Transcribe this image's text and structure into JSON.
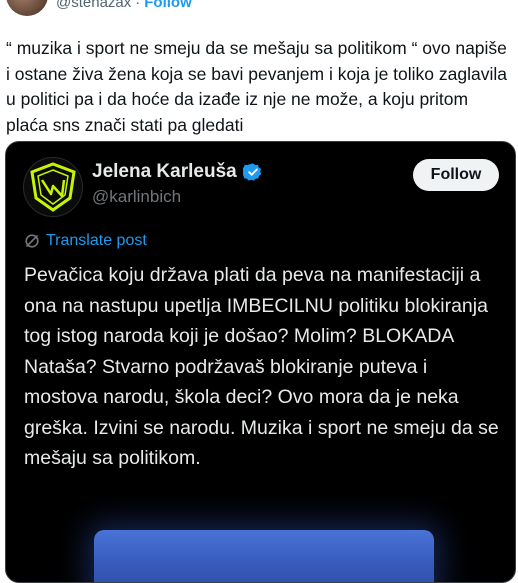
{
  "top": {
    "handle": "@stenazax",
    "follow_label": "Follow"
  },
  "tweet": {
    "text": "“ muzika i sport ne smeju da se mešaju sa politikom “ ovo napiše i ostane živa žena koja se bavi pevanjem i koja je toliko zaglavila u politici pa i da hoće da izađe iz nje ne može, a koju pritom plaća sns znači stati pa gledati"
  },
  "embed": {
    "name": "Jelena Karleuša",
    "handle": "@karlinbich",
    "follow_label": "Follow",
    "translate_label": "Translate post",
    "body": "Pevačica koju država plati da peva na manifestaciji a ona na nastupu upetlja IMBECILNU politiku blokiranja tog istog naroda koji je došao? Molim? BLOKADA Nataša? Stvarno podržavaš blokiranje puteva i mostova narodu, škola deci? Ovo mora da je neka greška. Izvini se narodu. Muzika i sport ne smeju da se mešaju sa politikom.",
    "verified_color": "#1d9bf0",
    "avatar_accent": "#c6f500"
  }
}
